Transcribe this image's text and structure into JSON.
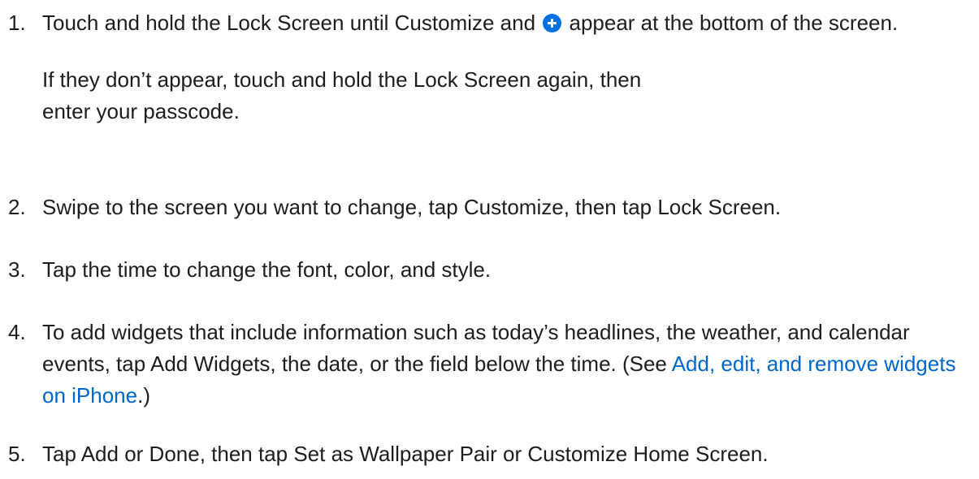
{
  "steps": [
    {
      "number": "1.",
      "text_before_icon": "Touch and hold the Lock Screen until Customize and ",
      "icon": "plus-circle-icon",
      "text_after_icon": " appear at the bottom of the screen.",
      "note": "If they don’t appear, touch and hold the Lock Screen again, then enter your passcode."
    },
    {
      "number": "2.",
      "text": "Swipe to the screen you want to change, tap Customize, then tap Lock Screen."
    },
    {
      "number": "3.",
      "text": "Tap the time to change the font, color, and style."
    },
    {
      "number": "4.",
      "text": "To add widgets that include information such as today’s headlines, the weather, and calendar events, tap Add Widgets, the date, or the field below the time. (See ",
      "link_text": "Add, edit, and remove widgets on iPhone",
      "text_after_link": ".)"
    },
    {
      "number": "5.",
      "text": "Tap Add or Done, then tap Set as Wallpaper Pair or Customize Home Screen."
    }
  ],
  "colors": {
    "text": "#1d1d1f",
    "link": "#0066cc",
    "icon": "#0071e3"
  }
}
